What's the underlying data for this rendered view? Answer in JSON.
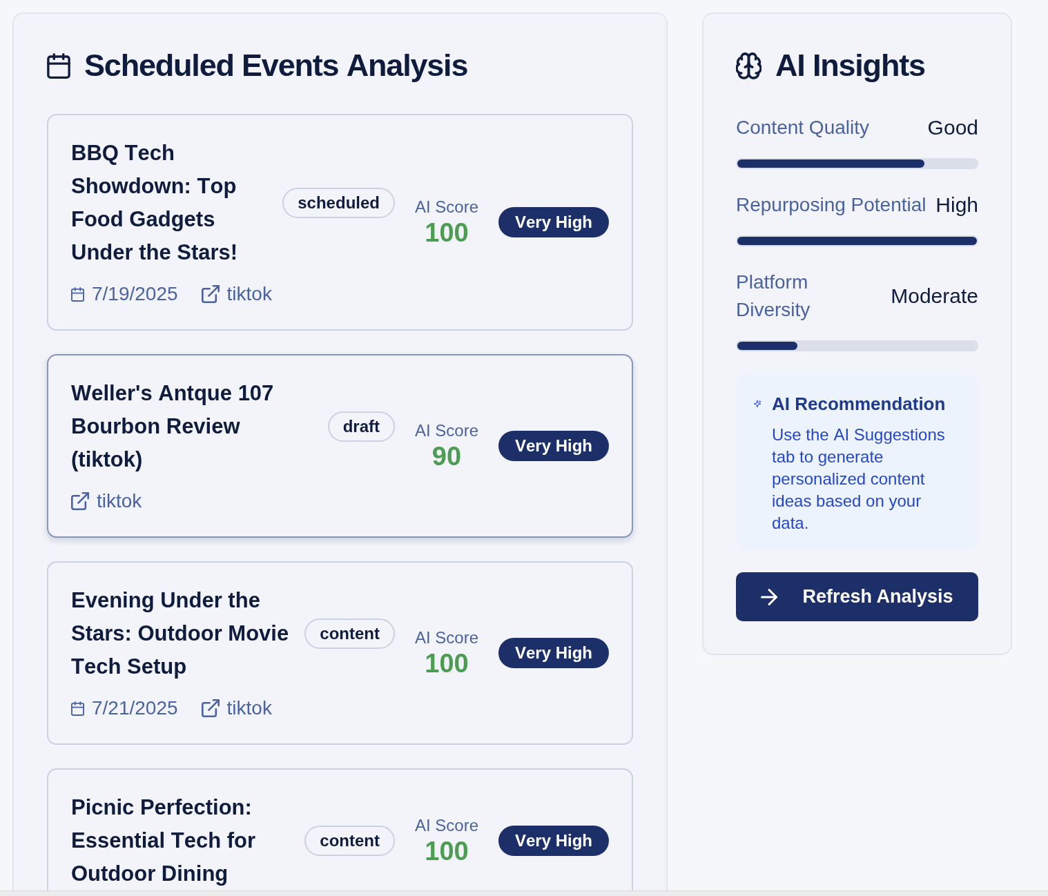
{
  "events_panel": {
    "title": "Scheduled Events Analysis",
    "events": [
      {
        "title": "BBQ Tech Showdown: Top Food Gadgets Under the Stars!",
        "status": "scheduled",
        "score_label": "AI Score",
        "score": "100",
        "rating": "Very High",
        "date": "7/19/2025",
        "platform": "tiktok",
        "hovered": false
      },
      {
        "title": "Weller's Antque 107 Bourbon Review (tiktok)",
        "status": "draft",
        "score_label": "AI Score",
        "score": "90",
        "rating": "Very High",
        "platform": "tiktok",
        "hovered": true
      },
      {
        "title": "Evening Under the Stars: Outdoor Movie Tech Setup",
        "status": "content",
        "score_label": "AI Score",
        "score": "100",
        "rating": "Very High",
        "date": "7/21/2025",
        "platform": "tiktok",
        "hovered": false
      },
      {
        "title": "Picnic Perfection: Essential Tech for Outdoor Dining",
        "status": "content",
        "score_label": "AI Score",
        "score": "100",
        "rating": "Very High",
        "hovered": false
      }
    ]
  },
  "insights_panel": {
    "title": "AI Insights",
    "metrics": [
      {
        "label": "Content Quality",
        "value": "Good",
        "level": 0.78
      },
      {
        "label": "Repurposing Potential",
        "value": "High",
        "level": 1
      },
      {
        "label": "Platform Diversity",
        "value": "Moderate",
        "level": 0.25
      }
    ],
    "recommendation": {
      "title": "AI Recommendation",
      "text": "Use the AI Suggestions tab to generate personalized content ideas based on your data."
    },
    "refresh_button": "Refresh Analysis"
  }
}
